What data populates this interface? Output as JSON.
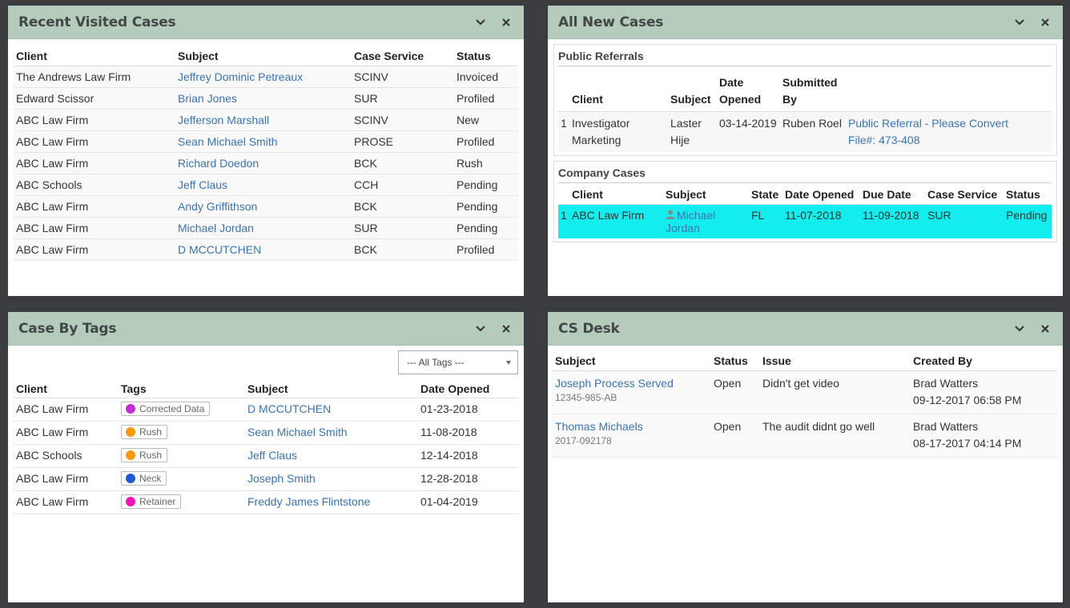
{
  "recent": {
    "title": "Recent Visited Cases",
    "columns": [
      "Client",
      "Subject",
      "Case Service",
      "Status"
    ],
    "rows": [
      {
        "client": "The Andrews Law Firm",
        "subject": "Jeffrey Dominic Petreaux",
        "service": "SCINV",
        "status": "Invoiced"
      },
      {
        "client": "Edward Scissor",
        "subject": "Brian Jones",
        "service": "SUR",
        "status": "Profiled"
      },
      {
        "client": "ABC Law Firm",
        "subject": "Jefferson Marshall",
        "service": "SCINV",
        "status": "New"
      },
      {
        "client": "ABC Law Firm",
        "subject": "Sean Michael Smith",
        "service": "PROSE",
        "status": "Profiled"
      },
      {
        "client": "ABC Law Firm",
        "subject": "Richard Doedon",
        "service": "BCK",
        "status": "Rush"
      },
      {
        "client": "ABC Schools",
        "subject": "Jeff Claus",
        "service": "CCH",
        "status": "Pending"
      },
      {
        "client": "ABC Law Firm",
        "subject": "Andy Griffithson",
        "service": "BCK",
        "status": "Pending"
      },
      {
        "client": "ABC Law Firm",
        "subject": "Michael Jordan",
        "service": "SUR",
        "status": "Pending"
      },
      {
        "client": "ABC Law Firm",
        "subject": "D MCCUTCHEN",
        "service": "BCK",
        "status": "Profiled"
      }
    ]
  },
  "new_cases": {
    "title": "All New Cases",
    "public_referrals": {
      "title": "Public Referrals",
      "columns": [
        "Client",
        "Subject",
        "Date Opened",
        "Submitted By"
      ],
      "rows": [
        {
          "num": "1",
          "client": "Investigator Marketing",
          "subject": "Laster Hije",
          "date": "03-14-2019",
          "submitted_by": "Ruben Roel",
          "action": "Public Referral - Please Convert",
          "file": "File#: 473-408"
        }
      ]
    },
    "company_cases": {
      "title": "Company Cases",
      "columns": [
        "Client",
        "Subject",
        "State",
        "Date Opened",
        "Due Date",
        "Case Service",
        "Status"
      ],
      "rows": [
        {
          "num": "1",
          "client": "ABC Law Firm",
          "subject": "Michael Jordan",
          "state": "FL",
          "opened": "11-07-2018",
          "due": "11-09-2018",
          "service": "SUR",
          "status": "Pending"
        }
      ]
    }
  },
  "tags": {
    "title": "Case By Tags",
    "filter": "--- All Tags ---",
    "columns": [
      "Client",
      "Tags",
      "Subject",
      "Date Opened"
    ],
    "rows": [
      {
        "client": "ABC Law Firm",
        "tag": "Corrected Data",
        "color": "#c52ed1",
        "subject": "D MCCUTCHEN",
        "date": "01-23-2018"
      },
      {
        "client": "ABC Law Firm",
        "tag": "Rush",
        "color": "#f59a12",
        "subject": "Sean Michael Smith",
        "date": "11-08-2018"
      },
      {
        "client": "ABC Schools",
        "tag": "Rush",
        "color": "#f59a12",
        "subject": "Jeff Claus",
        "date": "12-14-2018"
      },
      {
        "client": "ABC Law Firm",
        "tag": "Neck",
        "color": "#2159d6",
        "subject": "Joseph Smith",
        "date": "12-28-2018"
      },
      {
        "client": "ABC Law Firm",
        "tag": "Retainer",
        "color": "#ee15b8",
        "subject": "Freddy James Flintstone",
        "date": "01-04-2019"
      }
    ]
  },
  "cs_desk": {
    "title": "CS Desk",
    "columns": [
      "Subject",
      "Status",
      "Issue",
      "Created By"
    ],
    "rows": [
      {
        "subject": "Joseph Process Served",
        "sub": "12345-985-AB",
        "status": "Open",
        "issue": "Didn't get video",
        "creator": "Brad Watters",
        "created": "09-12-2017 06:58 PM"
      },
      {
        "subject": "Thomas Michaels",
        "sub": "2017-092178",
        "status": "Open",
        "issue": "The audit didnt go well",
        "creator": "Brad Watters",
        "created": "08-17-2017 04:14 PM"
      }
    ]
  }
}
